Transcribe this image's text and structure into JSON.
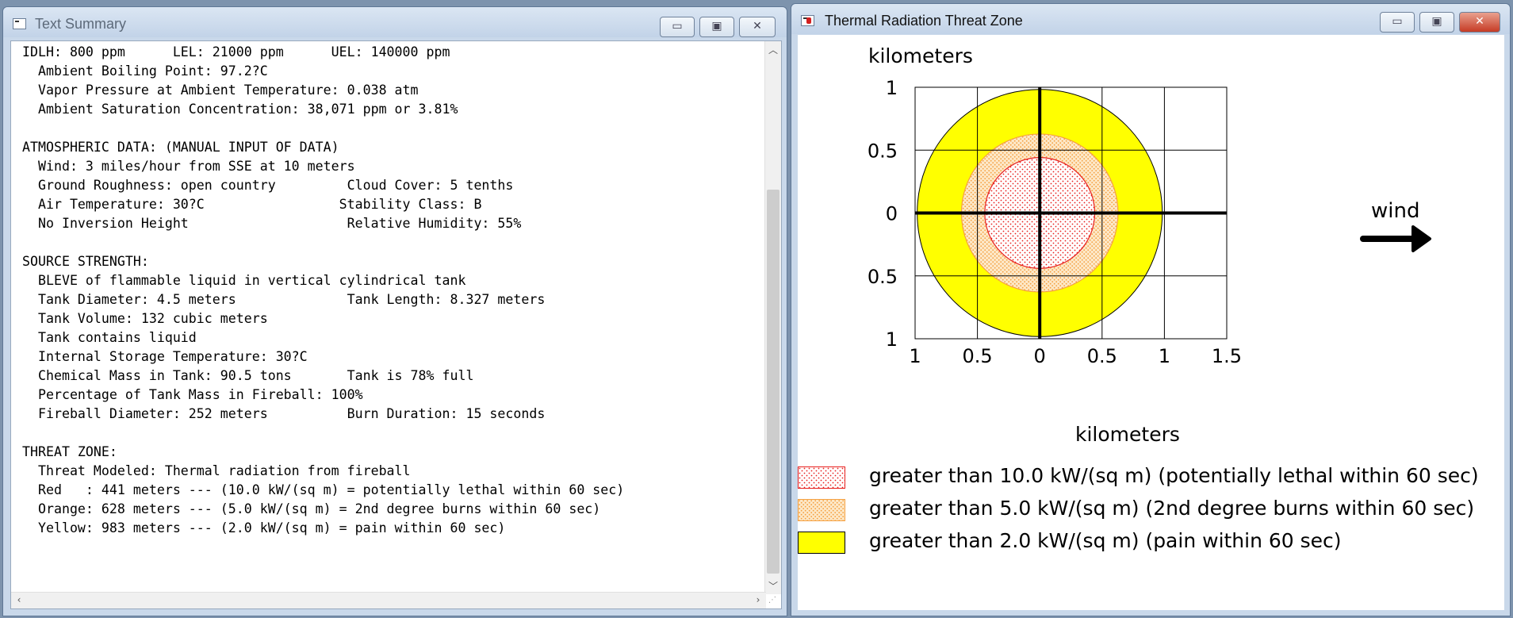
{
  "left_window": {
    "title": "Text Summary",
    "buttons": {
      "minimize": "▭",
      "maximize": "▣",
      "close": "✕"
    },
    "lines": [
      "IDLH: 800 ppm      LEL: 21000 ppm      UEL: 140000 ppm",
      "  Ambient Boiling Point: 97.2?C",
      "  Vapor Pressure at Ambient Temperature: 0.038 atm",
      "  Ambient Saturation Concentration: 38,071 ppm or 3.81%",
      "",
      "ATMOSPHERIC DATA: (MANUAL INPUT OF DATA)",
      "  Wind: 3 miles/hour from SSE at 10 meters",
      "  Ground Roughness: open country         Cloud Cover: 5 tenths",
      "  Air Temperature: 30?C                 Stability Class: B",
      "  No Inversion Height                    Relative Humidity: 55%",
      "",
      "SOURCE STRENGTH:",
      "  BLEVE of flammable liquid in vertical cylindrical tank",
      "  Tank Diameter: 4.5 meters              Tank Length: 8.327 meters",
      "  Tank Volume: 132 cubic meters",
      "  Tank contains liquid",
      "  Internal Storage Temperature: 30?C",
      "  Chemical Mass in Tank: 90.5 tons       Tank is 78% full",
      "  Percentage of Tank Mass in Fireball: 100%",
      "  Fireball Diameter: 252 meters          Burn Duration: 15 seconds",
      "",
      "THREAT ZONE:",
      "  Threat Modeled: Thermal radiation from fireball",
      "  Red   : 441 meters --- (10.0 kW/(sq m) = potentially lethal within 60 sec)",
      "  Orange: 628 meters --- (5.0 kW/(sq m) = 2nd degree burns within 60 sec)",
      "  Yellow: 983 meters --- (2.0 kW/(sq m) = pain within 60 sec)"
    ]
  },
  "right_window": {
    "title": "Thermal Radiation Threat Zone",
    "buttons": {
      "minimize": "▭",
      "maximize": "▣",
      "close": "✕"
    },
    "plot": {
      "y_axis_title": "kilometers",
      "x_axis_title": "kilometers",
      "y_tick_labels": [
        "1",
        "0.5",
        "0",
        "0.5",
        "1"
      ],
      "x_tick_labels": [
        "1",
        "0.5",
        "0",
        "0.5",
        "1",
        "1.5"
      ],
      "wind_label": "wind"
    },
    "legend": [
      {
        "text": "greater than 10.0 kW/(sq m) (potentially lethal within 60 sec)",
        "color": "#e8201e"
      },
      {
        "text": "greater than 5.0 kW/(sq m) (2nd degree burns within 60 sec)",
        "color": "#f5a040"
      },
      {
        "text": "greater than 2.0 kW/(sq m) (pain within 60 sec)",
        "color": "#ffff00"
      }
    ]
  },
  "chart_data": {
    "type": "area",
    "x_unit": "kilometers",
    "y_unit": "kilometers",
    "xlim": [
      -1,
      1.5
    ],
    "ylim": [
      -1,
      1
    ],
    "grid": true,
    "zones": [
      {
        "name": "Red",
        "radius_km": 0.441,
        "color": "#e8201e"
      },
      {
        "name": "Orange",
        "radius_km": 0.628,
        "color": "#f5a040"
      },
      {
        "name": "Yellow",
        "radius_km": 0.983,
        "color": "#ffff00"
      }
    ],
    "wind_direction": "east"
  }
}
